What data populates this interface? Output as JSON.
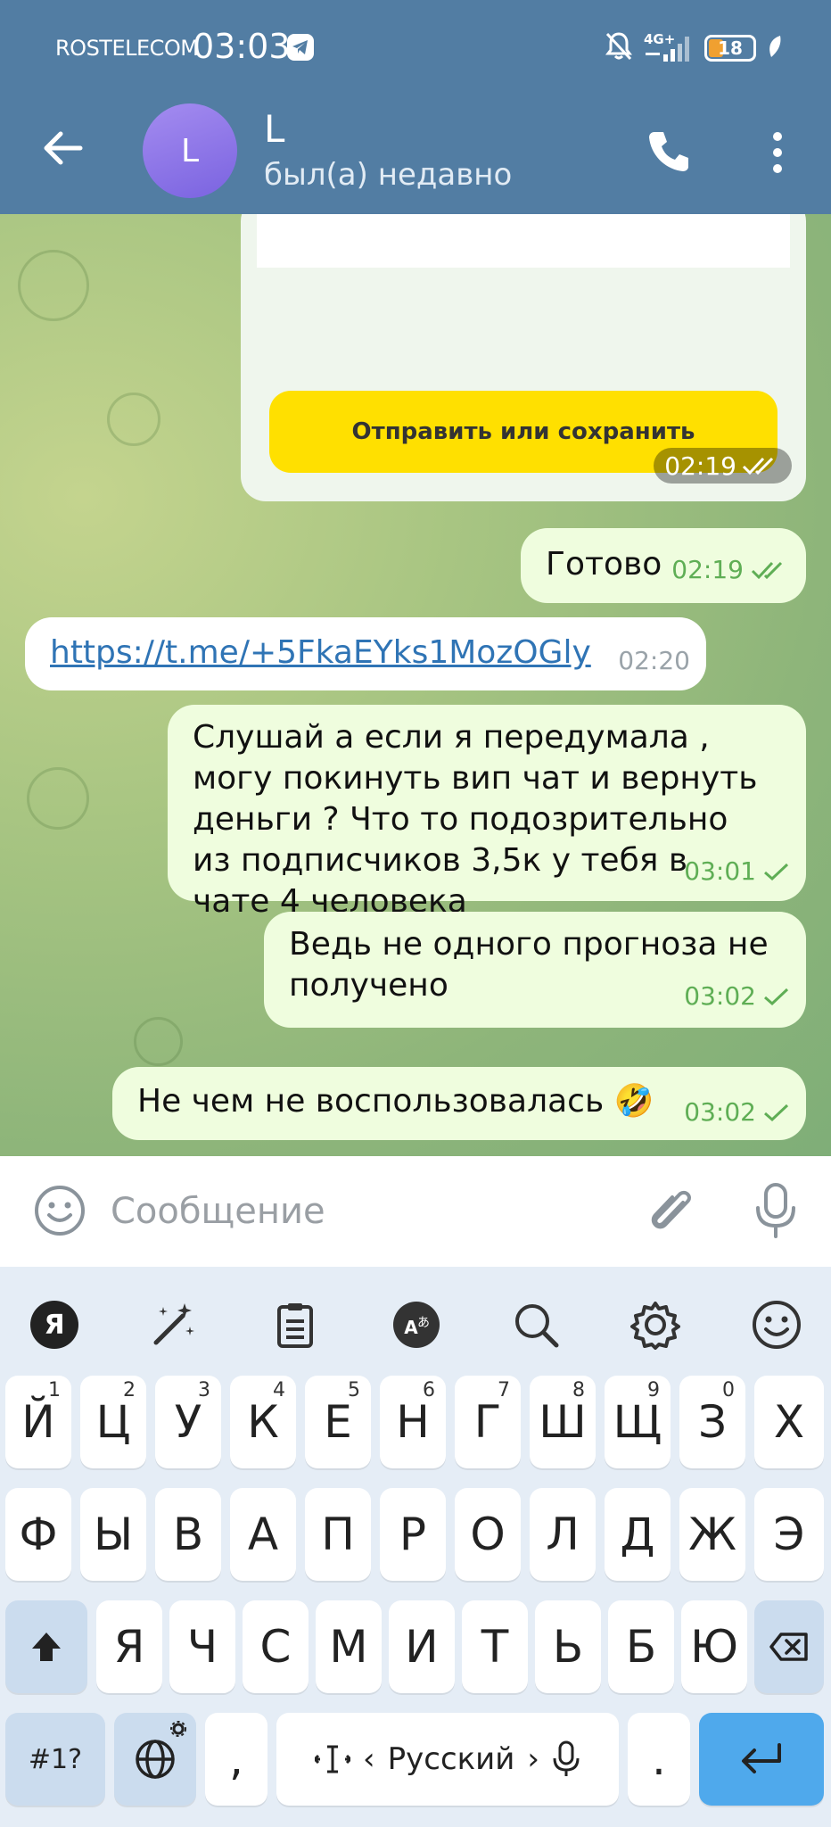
{
  "status_bar": {
    "carrier": "ROSTELECOM",
    "time": "03:03",
    "network": "4G+",
    "battery": "18"
  },
  "header": {
    "avatar_letter": "L",
    "name": "L",
    "status": "был(а) недавно"
  },
  "card": {
    "button_label": "Отправить или сохранить",
    "time": "02:19"
  },
  "messages": [
    {
      "direction": "out",
      "text": "Готово",
      "time": "02:19",
      "status": "read"
    },
    {
      "direction": "in",
      "text": "https://t.me/+5FkaEYks1MozOGly",
      "time": "02:20",
      "is_link": true
    },
    {
      "direction": "out",
      "text": "Слушай а если я передумала , могу покинуть вип чат и вернуть деньги ? Что то подозрительно из подписчиков 3,5к у тебя в чате 4 человека",
      "time": "03:01",
      "status": "sent"
    },
    {
      "direction": "out",
      "text": "Ведь не одного прогноза не получено",
      "time": "03:02",
      "status": "sent"
    },
    {
      "direction": "out",
      "text": "Не чем не воспользовалась 🤣",
      "time": "03:02",
      "status": "sent"
    }
  ],
  "input": {
    "placeholder": "Сообщение"
  },
  "keyboard": {
    "row1": [
      {
        "key": "Й",
        "hint": "1"
      },
      {
        "key": "Ц",
        "hint": "2"
      },
      {
        "key": "У",
        "hint": "3"
      },
      {
        "key": "К",
        "hint": "4"
      },
      {
        "key": "Е",
        "hint": "5"
      },
      {
        "key": "Н",
        "hint": "6"
      },
      {
        "key": "Г",
        "hint": "7"
      },
      {
        "key": "Ш",
        "hint": "8"
      },
      {
        "key": "Щ",
        "hint": "9"
      },
      {
        "key": "З",
        "hint": "0"
      },
      {
        "key": "Х",
        "hint": ""
      }
    ],
    "row2": [
      "Ф",
      "Ы",
      "В",
      "А",
      "П",
      "Р",
      "О",
      "Л",
      "Д",
      "Ж",
      "Э"
    ],
    "row3": [
      "Я",
      "Ч",
      "С",
      "М",
      "И",
      "Т",
      "Ь",
      "Б",
      "Ю"
    ],
    "symbols_label": "#1?",
    "comma_label": ",",
    "period_label": ".",
    "space_label": "Русский",
    "space_left_arrow": "‹",
    "space_right_arrow": "›"
  },
  "colors": {
    "header": "#527da3",
    "outgoing_bubble": "#effdde",
    "incoming_bubble": "#ffffff",
    "check_green": "#5fae55",
    "link_blue": "#2f74b5",
    "yellow_button": "#ffe000",
    "enter_key": "#4fa9ec"
  }
}
